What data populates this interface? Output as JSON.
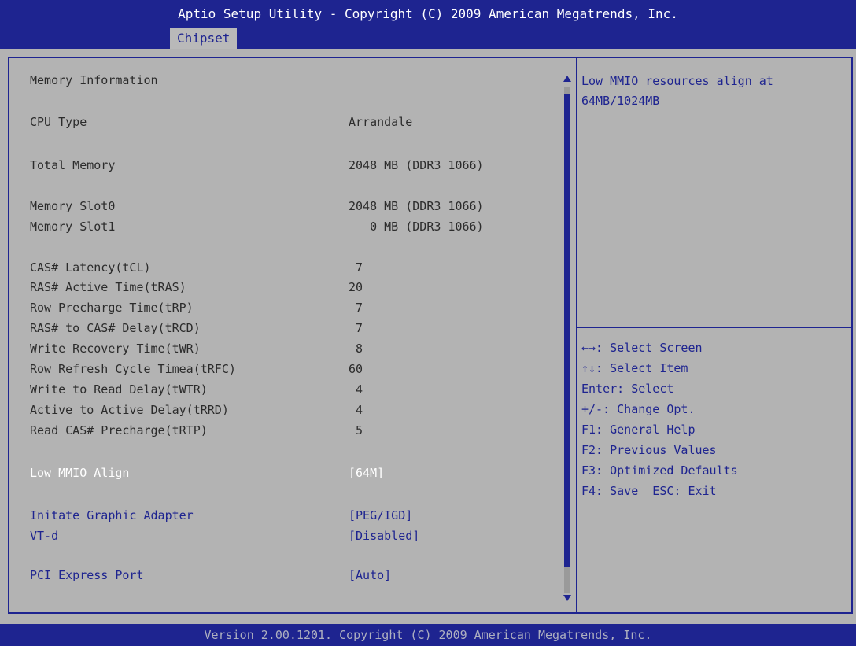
{
  "header": {
    "title": "Aptio Setup Utility - Copyright (C) 2009 American Megatrends, Inc.",
    "active_tab": "Chipset"
  },
  "main": {
    "section_title": "Memory Information",
    "info": [
      {
        "label": "CPU Type",
        "value": "Arrandale"
      },
      {
        "label": "Total Memory",
        "value": "2048 MB (DDR3 1066)"
      },
      {
        "label": "Memory Slot0",
        "value": "2048 MB (DDR3 1066)"
      },
      {
        "label": "Memory Slot1",
        "value": "   0 MB (DDR3 1066)"
      },
      {
        "label": "CAS# Latency(tCL)",
        "value": " 7"
      },
      {
        "label": "RAS# Active Time(tRAS)",
        "value": "20"
      },
      {
        "label": "Row Precharge Time(tRP)",
        "value": " 7"
      },
      {
        "label": "RAS# to CAS# Delay(tRCD)",
        "value": " 7"
      },
      {
        "label": "Write Recovery Time(tWR)",
        "value": " 8"
      },
      {
        "label": "Row Refresh Cycle Timea(tRFC)",
        "value": "60"
      },
      {
        "label": "Write to Read Delay(tWTR)",
        "value": " 4"
      },
      {
        "label": "Active to Active Delay(tRRD)",
        "value": " 4"
      },
      {
        "label": "Read CAS# Precharge(tRTP)",
        "value": " 5"
      }
    ],
    "options": [
      {
        "label": "Low MMIO Align",
        "value": "[64M]"
      },
      {
        "label": "Initate Graphic Adapter",
        "value": "[PEG/IGD]"
      },
      {
        "label": "VT-d",
        "value": "[Disabled]"
      },
      {
        "label": "PCI Express Port",
        "value": "[Auto]"
      }
    ]
  },
  "help": {
    "description_line1": "Low MMIO resources align at",
    "description_line2": "64MB/1024MB",
    "keys": [
      "←→: Select Screen",
      "↑↓: Select Item",
      "Enter: Select",
      "+/-: Change Opt.",
      "F1: General Help",
      "F2: Previous Values",
      "F3: Optimized Defaults",
      "F4: Save  ESC: Exit"
    ]
  },
  "footer": {
    "version": "Version 2.00.1201. Copyright (C) 2009 American Megatrends, Inc."
  },
  "colors": {
    "bar_blue": "#1e2490",
    "background_gray": "#b3b3b3",
    "text_dark": "#2c2c2c",
    "selected_text": "#ffffff"
  }
}
